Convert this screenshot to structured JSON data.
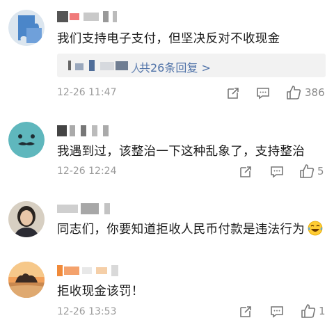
{
  "comments": [
    {
      "text": "我们支持电子支付，但坚决反对不收现金",
      "reply_summary": {
        "name_tail": "人",
        "count_text": "共26条回复 >"
      },
      "time": "12-26 11:47",
      "likes": "386",
      "avatar_icon": "puzzle-avatar-icon"
    },
    {
      "text": "我遇到过，该整治一下这种乱象了，支持整治",
      "time": "12-26 12:24",
      "likes": "5",
      "avatar_icon": "mustache-face-avatar-icon"
    },
    {
      "text": "同志们，你要知道拒收人民币付款是违法行为",
      "emoji": "laughing-tears-emoji",
      "avatar_icon": "person-photo-avatar"
    },
    {
      "text": "拒收现金该罚！",
      "time": "12-26 13:53",
      "likes": "1",
      "avatar_icon": "sunset-photo-avatar"
    }
  ],
  "colors": {
    "link_blue": "#4f72a8",
    "meta_gray": "#9a9a9a",
    "reply_bg": "#f2f2f2"
  }
}
